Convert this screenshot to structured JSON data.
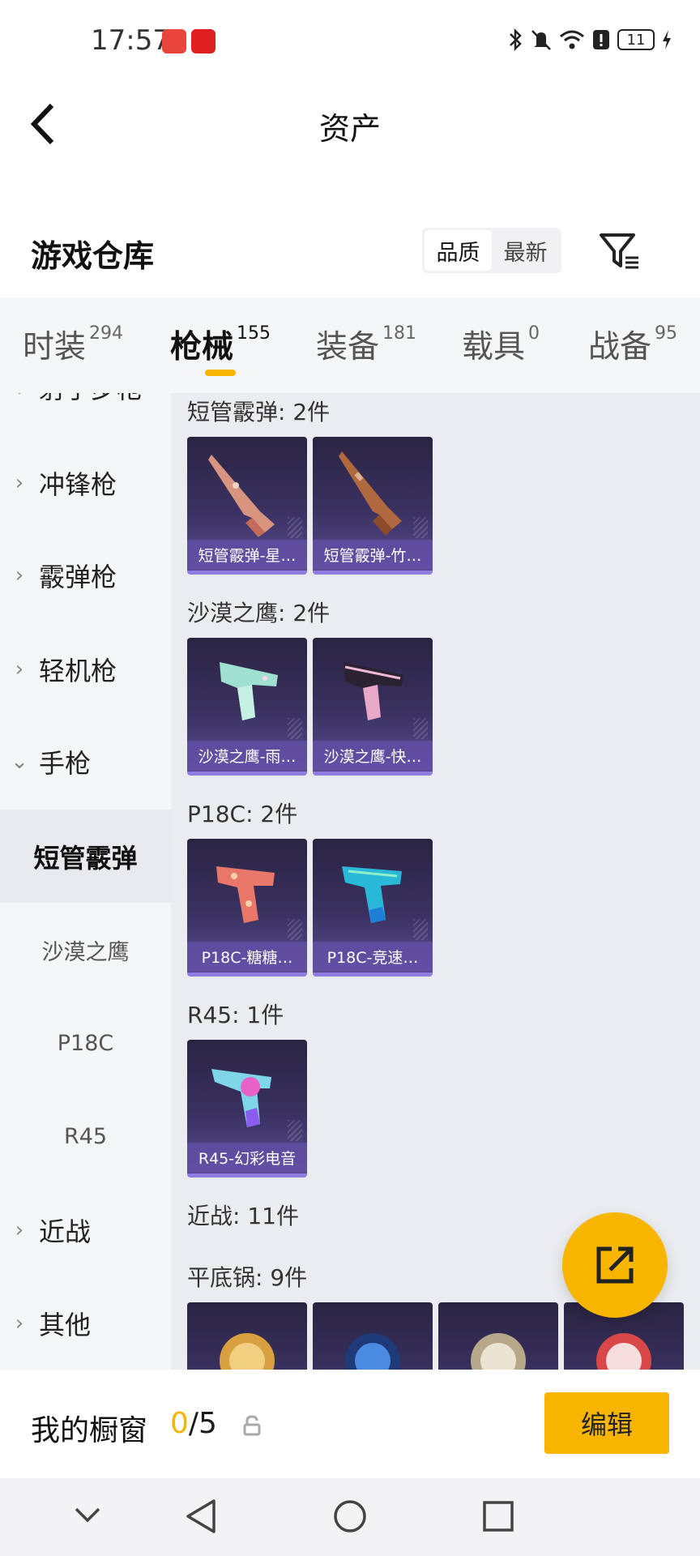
{
  "status_bar": {
    "time": "17:57",
    "battery": "11",
    "icons": [
      "bluetooth-icon",
      "mute-icon",
      "wifi-icon",
      "alert-icon",
      "battery-icon",
      "charging-icon"
    ]
  },
  "header": {
    "title": "资产"
  },
  "warehouse": {
    "title": "游戏仓库",
    "sort_options": [
      "品质",
      "最新"
    ],
    "active_sort": "品质"
  },
  "tabs": [
    {
      "label": "时装",
      "count": "294"
    },
    {
      "label": "枪械",
      "count": "155",
      "active": true
    },
    {
      "label": "装备",
      "count": "181"
    },
    {
      "label": "载具",
      "count": "0"
    },
    {
      "label": "战备",
      "count": "95"
    }
  ],
  "sidebar": {
    "partial_top": "射手步枪",
    "categories": [
      {
        "label": "冲锋枪",
        "chevron": "›"
      },
      {
        "label": "霰弹枪",
        "chevron": "›"
      },
      {
        "label": "轻机枪",
        "chevron": "›"
      },
      {
        "label": "手枪",
        "chevron": "⌄"
      }
    ],
    "subcategories": [
      "短管霰弹",
      "沙漠之鹰",
      "P18C",
      "R45"
    ],
    "more_categories": [
      {
        "label": "近战",
        "chevron": "›"
      },
      {
        "label": "其他",
        "chevron": "›"
      }
    ]
  },
  "groups": [
    {
      "title": "短管霰弹: 2件",
      "items": [
        "短管霰弹-星…",
        "短管霰弹-竹…"
      ]
    },
    {
      "title": "沙漠之鹰: 2件",
      "items": [
        "沙漠之鹰-雨…",
        "沙漠之鹰-快…"
      ]
    },
    {
      "title": "P18C: 2件",
      "items": [
        "P18C-糖糖…",
        "P18C-竞速…"
      ]
    },
    {
      "title": "R45: 1件",
      "items": [
        "R45-幻彩电音"
      ]
    },
    {
      "title": "近战: 11件",
      "items": []
    },
    {
      "title": "平底锅: 9件",
      "items": []
    }
  ],
  "showcase": {
    "label": "我的橱窗",
    "current": "0",
    "total": "/5",
    "edit_label": "编辑"
  },
  "colors": {
    "accent": "#f7b500",
    "card_bg": "#3a3160",
    "card_border": "#8f7de0"
  }
}
